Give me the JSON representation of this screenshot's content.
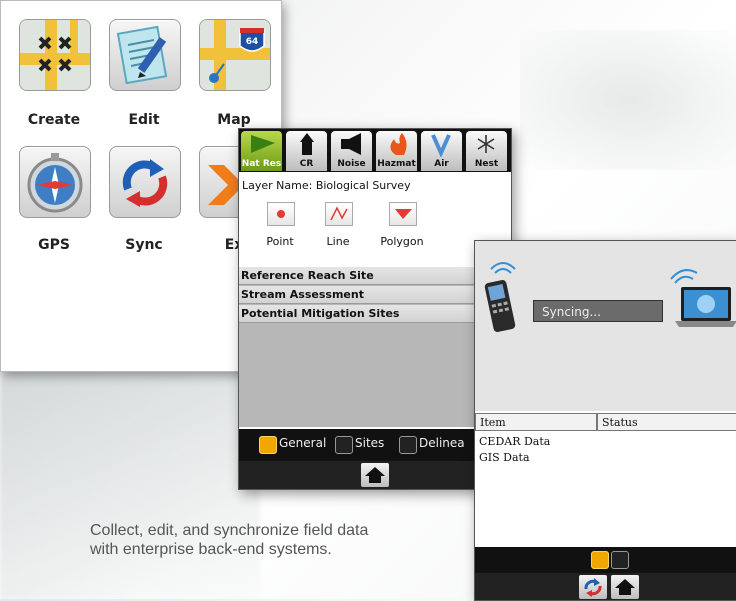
{
  "launcher": {
    "apps": [
      {
        "label": "Create",
        "icon": "create-map-icon"
      },
      {
        "label": "Edit",
        "icon": "edit-document-icon"
      },
      {
        "label": "Map",
        "icon": "map-highway-icon",
        "badge": "64"
      },
      {
        "label": "GPS",
        "icon": "compass-icon"
      },
      {
        "label": "Sync",
        "icon": "sync-arrows-icon"
      },
      {
        "label": "Ex",
        "icon": "export-arrow-icon"
      }
    ]
  },
  "layer_editor": {
    "tabs": [
      "Nat Res",
      "CR",
      "Noise",
      "Hazmat",
      "Air",
      "Nest"
    ],
    "layer_name": "Layer Name: Biological Survey",
    "geometry": [
      "Point",
      "Line",
      "Polygon"
    ],
    "layers": [
      "Reference Reach Site",
      "Stream Assessment",
      "Potential Mitigation Sites"
    ],
    "filters": [
      "General",
      "Sites",
      "Delinea"
    ]
  },
  "sync_panel": {
    "status_text": "Syncing...",
    "columns": [
      "Item",
      "Status"
    ],
    "rows": [
      "CEDAR Data",
      "GIS Data"
    ]
  },
  "caption": {
    "line1": "Collect, edit, and synchronize field data",
    "line2": "with enterprise back-end systems."
  },
  "colors": {
    "accent_orange": "#f0a800",
    "active_tab_green": "#7aa61f",
    "toolbar_black": "#111111"
  }
}
